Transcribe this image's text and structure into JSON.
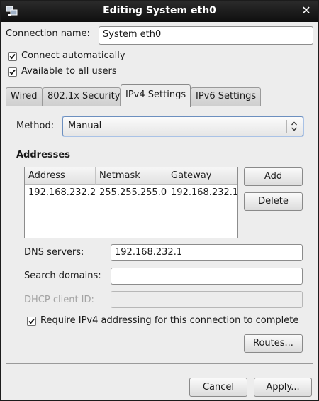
{
  "window": {
    "title": "Editing System eth0"
  },
  "connection": {
    "name_label": "Connection name:",
    "name_value": "System eth0",
    "auto_connect_label": "Connect automatically",
    "auto_connect_checked": true,
    "all_users_label": "Available to all users",
    "all_users_checked": true
  },
  "tabs": [
    {
      "label": "Wired",
      "active": false
    },
    {
      "label": "802.1x Security",
      "active": false
    },
    {
      "label": "IPv4 Settings",
      "active": true
    },
    {
      "label": "IPv6 Settings",
      "active": false
    }
  ],
  "ipv4": {
    "method_label": "Method:",
    "method_value": "Manual",
    "addresses_heading": "Addresses",
    "columns": [
      "Address",
      "Netmask",
      "Gateway"
    ],
    "rows": [
      {
        "address": "192.168.232.2",
        "netmask": "255.255.255.0",
        "gateway": "192.168.232.1"
      }
    ],
    "add_label": "Add",
    "delete_label": "Delete",
    "dns_label": "DNS servers:",
    "dns_value": "192.168.232.1",
    "search_label": "Search domains:",
    "search_value": "",
    "dhcp_label": "DHCP client ID:",
    "dhcp_value": "",
    "require_label": "Require IPv4 addressing for this connection to complete",
    "require_checked": true,
    "routes_label": "Routes..."
  },
  "footer": {
    "cancel_label": "Cancel",
    "apply_label": "Apply..."
  },
  "colors": {
    "titlebar": "#151515",
    "window_bg": "#ededed",
    "focus_border": "#6c8fbf"
  }
}
